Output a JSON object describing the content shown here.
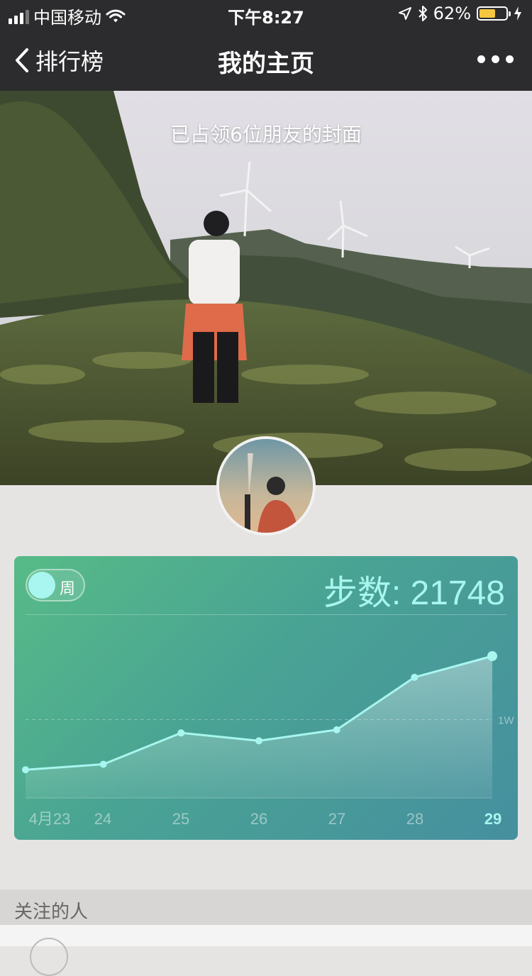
{
  "status_bar": {
    "carrier": "中国移动",
    "time": "下午8:27",
    "battery": "62%",
    "battery_level": 0.62,
    "battery_color": "#f5c641"
  },
  "nav": {
    "back_label": "排行榜",
    "title": "我的主页",
    "more_icon": "more-icon"
  },
  "cover": {
    "caption": "已占领6位朋友的封面"
  },
  "step_card": {
    "toggle_label": "周",
    "steps_text": "步数: 21748",
    "accent": "#a8f6ef"
  },
  "chart_data": {
    "type": "area",
    "x": [
      "4月23",
      "24",
      "25",
      "26",
      "27",
      "28",
      "29"
    ],
    "values": [
      3600,
      4300,
      8300,
      7300,
      8700,
      15400,
      18100
    ],
    "reference_line": {
      "value": 10000,
      "label": "1W"
    },
    "ylim": [
      0,
      20000
    ],
    "highlight_index": 6
  },
  "follow_section": {
    "label": "关注的人"
  }
}
